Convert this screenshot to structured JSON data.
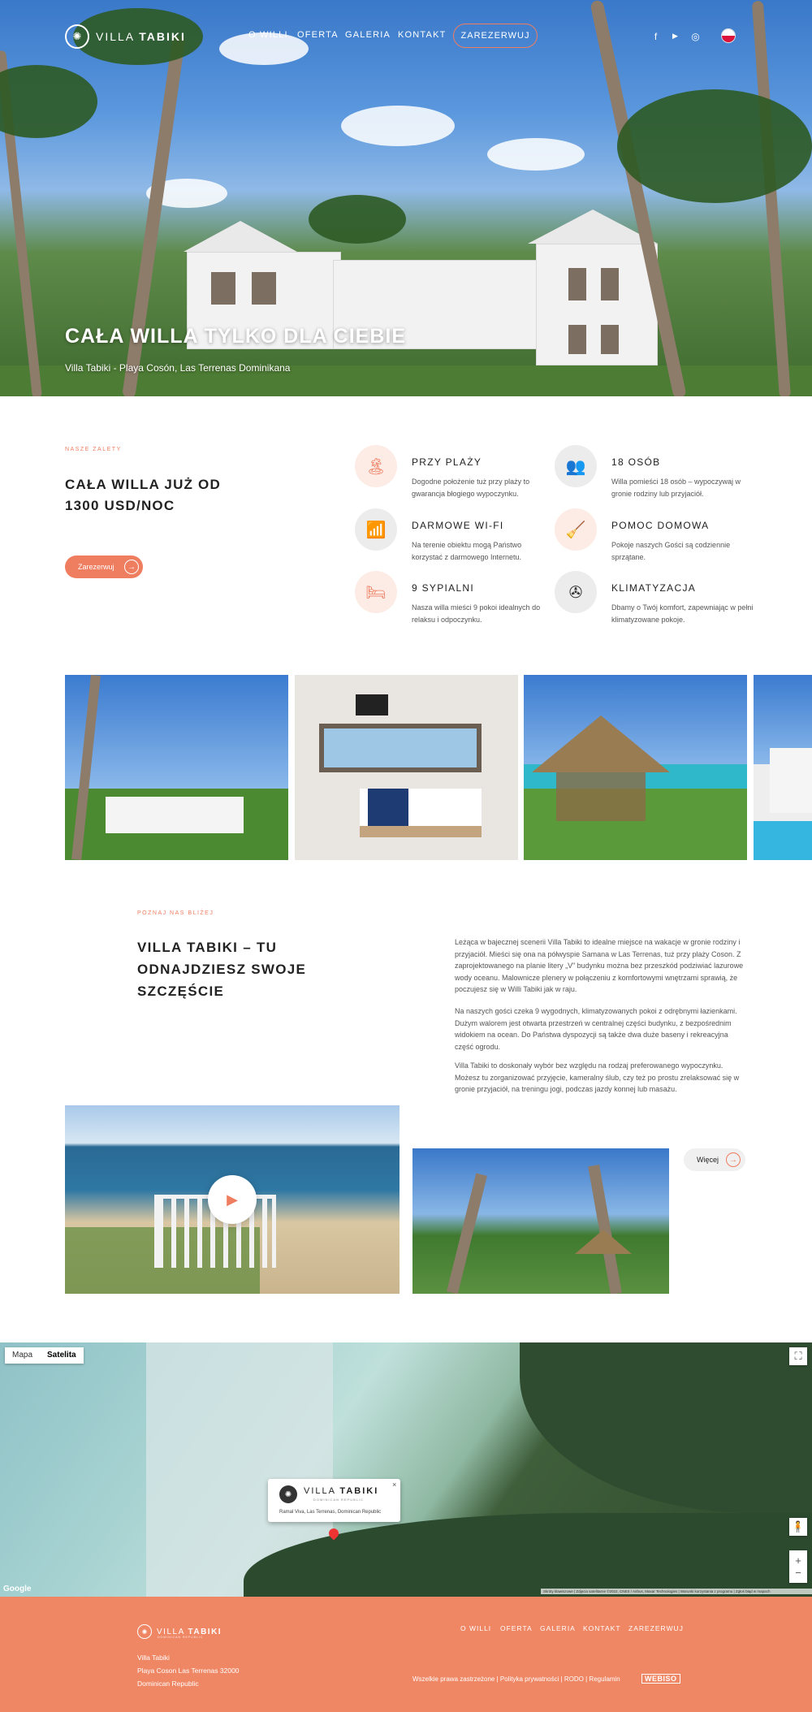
{
  "header": {
    "logo_mark": "✺",
    "logo_light": "VILLA",
    "logo_bold": "TABIKI",
    "nav": [
      "O WILLI",
      "OFERTA",
      "GALERIA",
      "KONTAKT"
    ],
    "reserve": "ZAREZERWUJ",
    "social": [
      {
        "name": "facebook-icon",
        "glyph": "f"
      },
      {
        "name": "youtube-icon",
        "glyph": "▶"
      },
      {
        "name": "instagram-icon",
        "glyph": "◎"
      }
    ],
    "lang": "pl"
  },
  "hero": {
    "title": "CAŁA WILLA TYLKO DLA CIEBIE",
    "subtitle": "Villa Tabiki - Playa Cosón, Las Terrenas Dominikana"
  },
  "features": {
    "eyebrow": "NASZE ZALETY",
    "price": "CAŁA WILLA JUŻ OD 1300 USD/NOC",
    "button": "Zarezerwuj",
    "items": [
      {
        "title": "PRZY PLAŻY",
        "text": "Dogodne położenie tuż przy plaży to gwarancja błogiego wypoczynku.",
        "icon": "🏝"
      },
      {
        "title": "18 OSÓB",
        "text": "Willa pomieści 18 osób – wypoczywaj w gronie rodziny lub przyjaciół.",
        "icon": "👥"
      },
      {
        "title": "DARMOWE WI-FI",
        "text": "Na terenie obiektu mogą Państwo korzystać z darmowego Internetu.",
        "icon": "📶"
      },
      {
        "title": "POMOC DOMOWA",
        "text": "Pokoje naszych Gości są codziennie sprzątane.",
        "icon": "🧹"
      },
      {
        "title": "9 SYPIALNI",
        "text": "Nasza willa mieści 9 pokoi idealnych do relaksu i odpoczynku.",
        "icon": "🛏"
      },
      {
        "title": "KLIMATYZACJA",
        "text": "Dbamy o Twój komfort, zapewniając w pełni klimatyzowane pokoje.",
        "icon": "✇"
      }
    ]
  },
  "about": {
    "eyebrow": "POZNAJ NAS BLIŻEJ",
    "title": "VILLA TABIKI – TU ODNAJDZIESZ SWOJE SZCZĘŚCIE",
    "paragraphs": [
      "Leżąca w bajecznej scenerii Villa Tabiki to idealne miejsce na wakacje w gronie rodziny i przyjaciół. Mieści się ona na półwyspie Samana w Las Terrenas, tuż przy plaży Coson. Z zaprojektowanego na planie litery „V” budynku można bez przeszkód podziwiać lazurowe wody oceanu. Malownicze plenery w połączeniu z komfortowymi wnętrzami sprawią, że poczujesz się w Willi Tabiki jak w raju.",
      "Na naszych gości czeka 9 wygodnych, klimatyzowanych pokoi z odrębnymi łazienkami. Dużym walorem jest otwarta przestrzeń w centralnej części budynku, z bezpośrednim widokiem na ocean. Do Państwa dyspozycji są także dwa duże baseny i rekreacyjna część ogrodu.",
      "Villa Tabiki to doskonały wybór bez względu na rodzaj preferowanego wypoczynku. Możesz tu zorganizować przyjęcie, kameralny ślub, czy też po prostu zrelaksować się w gronie przyjaciół, na treningu jogi, podczas jazdy konnej lub masażu."
    ],
    "more": "Więcej"
  },
  "map": {
    "types": [
      "Mapa",
      "Satelita"
    ],
    "info_logo_light": "VILLA",
    "info_logo_bold": "TABIKI",
    "info_logo_tag": "DOMINICAN REPUBLIC",
    "info_address": "Ramal Viva, Las Terrenas, Dominican Republic",
    "google": "Google",
    "attribution": "Skróty klawiszowe | Zdjęcia satelitarne ©2022, CNES / Airbus, Maxar Technologies | Warunki korzystania z programu | Zgłoś błąd w mapach"
  },
  "footer": {
    "logo_light": "VILLA",
    "logo_bold": "TABIKI",
    "logo_tag": "DOMINICAN REPUBLIC",
    "nav": [
      "O WILLI",
      "OFERTA",
      "GALERIA",
      "KONTAKT",
      "ZAREZERWUJ"
    ],
    "address": [
      "Villa Tabiki",
      "Playa Coson Las Terrenas 32000",
      "Dominican Republic"
    ],
    "legal": "Wszelkie prawa zastrzeżone | Polityka prywatności | RODO | Regulamin",
    "agency": "WEBISO"
  }
}
